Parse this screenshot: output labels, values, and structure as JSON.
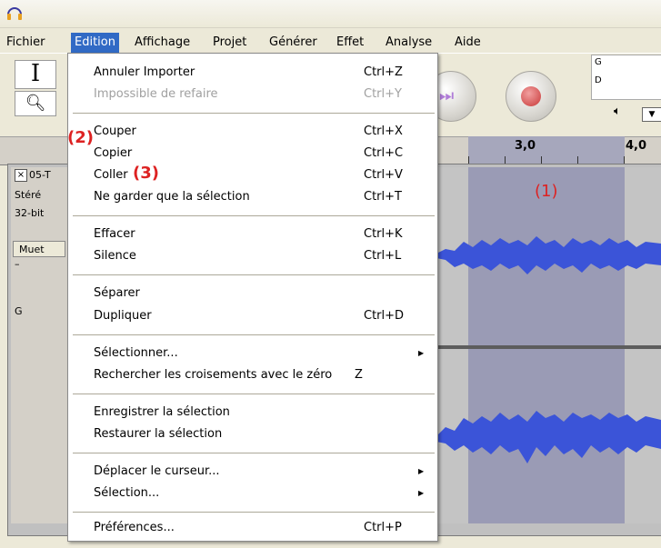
{
  "menubar": {
    "items": [
      "Fichier",
      "Edition",
      "Affichage",
      "Projet",
      "Générer",
      "Effet",
      "Analyse",
      "Aide"
    ],
    "active": "Edition"
  },
  "edit_menu": {
    "undo": {
      "label": "Annuler Importer",
      "shortcut": "Ctrl+Z"
    },
    "redo": {
      "label": "Impossible de refaire",
      "shortcut": "Ctrl+Y"
    },
    "cut": {
      "label": "Couper",
      "shortcut": "Ctrl+X"
    },
    "copy": {
      "label": "Copier",
      "shortcut": "Ctrl+C"
    },
    "paste": {
      "label": "Coller",
      "shortcut": "Ctrl+V"
    },
    "trim": {
      "label": "Ne garder que la sélection",
      "shortcut": "Ctrl+T"
    },
    "delete": {
      "label": "Effacer",
      "shortcut": "Ctrl+K"
    },
    "silence": {
      "label": "Silence",
      "shortcut": "Ctrl+L"
    },
    "split": {
      "label": "Séparer"
    },
    "duplicate": {
      "label": "Dupliquer",
      "shortcut": "Ctrl+D"
    },
    "select": {
      "label": "Sélectionner..."
    },
    "zero_cross": {
      "label": "Rechercher les croisements avec le zéro",
      "shortcut": "Z"
    },
    "save_sel": {
      "label": "Enregistrer la sélection"
    },
    "restore_sel": {
      "label": "Restaurer la sélection"
    },
    "move_cursor": {
      "label": "Déplacer le curseur..."
    },
    "selection": {
      "label": "Sélection..."
    },
    "prefs": {
      "label": "Préférences...",
      "shortcut": "Ctrl+P"
    }
  },
  "annotations": {
    "one": "(1)",
    "two": "(2)",
    "three": "(3)"
  },
  "ruler": {
    "labels": [
      "3,0",
      "4,0"
    ]
  },
  "meter": {
    "g": "G",
    "d": "D"
  },
  "track": {
    "name": "05-T",
    "channels": "Stéré",
    "format": "32-bit",
    "mute": "Muet",
    "gain_label": "–",
    "pan_label": "G",
    "close": "×"
  },
  "colors": {
    "menu_highlight": "#316ac5",
    "annotation": "#dd2222",
    "waveform": "#3b54d8",
    "selection": "#9a9bb5"
  },
  "icons": {
    "app": "audacity-headphones-icon",
    "play_skip": "skip-end-icon",
    "record": "record-icon",
    "volume": "speaker-icon"
  }
}
